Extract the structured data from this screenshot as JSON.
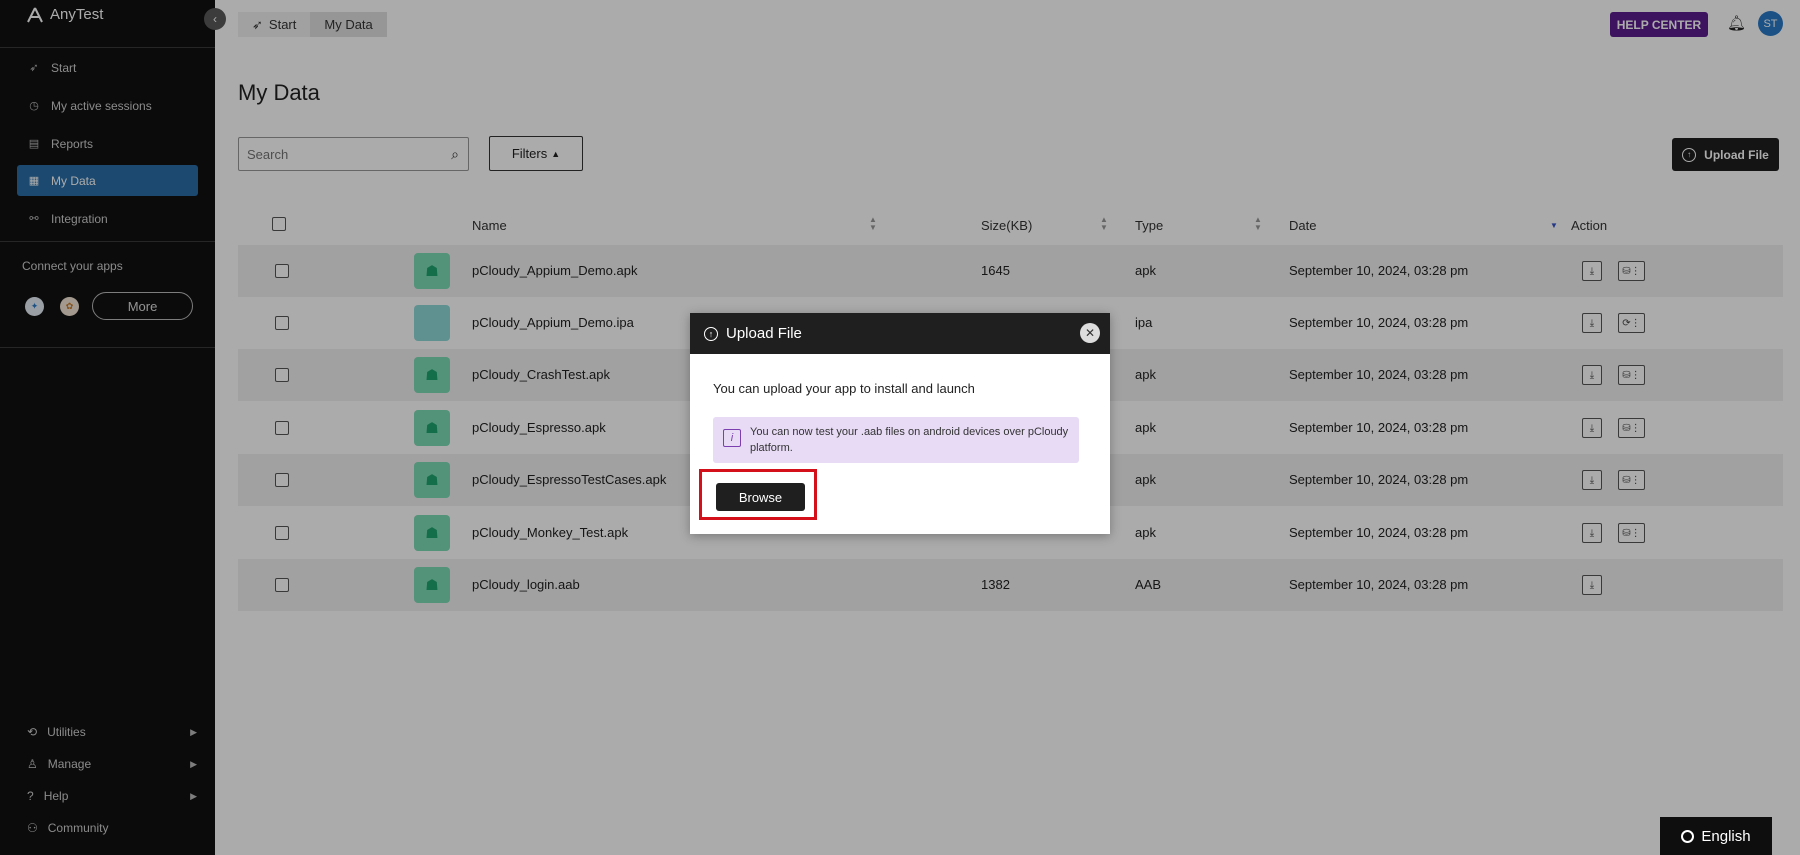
{
  "app": {
    "name": "AnyTest"
  },
  "sidebar": {
    "items": [
      {
        "label": "Start",
        "icon": "rocket-icon"
      },
      {
        "label": "My active sessions",
        "icon": "clock-icon"
      },
      {
        "label": "Reports",
        "icon": "report-icon"
      },
      {
        "label": "My Data",
        "icon": "database-icon",
        "active": true
      },
      {
        "label": "Integration",
        "icon": "integration-icon"
      }
    ],
    "connect_label": "Connect your apps",
    "more_label": "More",
    "bottom": [
      {
        "label": "Utilities",
        "icon": "utilities-icon"
      },
      {
        "label": "Manage",
        "icon": "user-icon"
      },
      {
        "label": "Help",
        "icon": "help-icon"
      },
      {
        "label": "Community",
        "icon": "community-icon"
      }
    ]
  },
  "header": {
    "breadcrumbs": [
      "Start",
      "My Data"
    ],
    "help_center": "HELP CENTER",
    "avatar_initials": "ST"
  },
  "main": {
    "title": "My Data",
    "search_placeholder": "Search",
    "filters_label": "Filters",
    "upload_label": "Upload File"
  },
  "table": {
    "columns": [
      "Name",
      "Size(KB)",
      "Type",
      "Date",
      "Action"
    ],
    "rows": [
      {
        "name": "pCloudy_Appium_Demo.apk",
        "size": "1645",
        "type": "apk",
        "date": "September 10, 2024, 03:28 pm",
        "icon": "android-icon"
      },
      {
        "name": "pCloudy_Appium_Demo.ipa",
        "size": "",
        "type": "ipa",
        "date": "September 10, 2024, 03:28 pm",
        "icon": "apple-icon"
      },
      {
        "name": "pCloudy_CrashTest.apk",
        "size": "",
        "type": "apk",
        "date": "September 10, 2024, 03:28 pm",
        "icon": "android-icon"
      },
      {
        "name": "pCloudy_Espresso.apk",
        "size": "",
        "type": "apk",
        "date": "September 10, 2024, 03:28 pm",
        "icon": "android-icon"
      },
      {
        "name": "pCloudy_EspressoTestCases.apk",
        "size": "",
        "type": "apk",
        "date": "September 10, 2024, 03:28 pm",
        "icon": "android-icon"
      },
      {
        "name": "pCloudy_Monkey_Test.apk",
        "size": "",
        "type": "apk",
        "date": "September 10, 2024, 03:28 pm",
        "icon": "android-icon"
      },
      {
        "name": "pCloudy_login.aab",
        "size": "1382",
        "type": "AAB",
        "date": "September 10, 2024, 03:28 pm",
        "icon": "android-icon"
      }
    ]
  },
  "modal": {
    "title": "Upload File",
    "text": "You can upload your app to install and launch",
    "info_line1": "You can now test your .aab files on android devices over pCloudy",
    "info_line2": "platform.",
    "browse_label": "Browse"
  },
  "language": {
    "label": "English"
  },
  "colors": {
    "accent": "#2b6ea6",
    "help_center": "#5b1d8f",
    "highlight": "#d4101a"
  }
}
